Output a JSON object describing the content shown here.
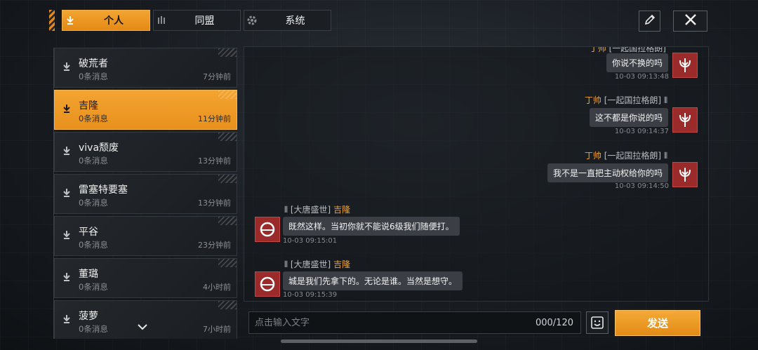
{
  "tabs": [
    {
      "label": "个人",
      "icon": "person-pin-icon",
      "active": true
    },
    {
      "label": "同盟",
      "icon": "alliance-icon",
      "active": false
    },
    {
      "label": "系统",
      "icon": "gear-icon",
      "active": false
    }
  ],
  "toolbar": {
    "edit_icon": "pencil-icon",
    "close_icon": "close-icon"
  },
  "conversations": [
    {
      "name": "破荒者",
      "count": "0条消息",
      "time": "7分钟前"
    },
    {
      "name": "吉隆",
      "count": "0条消息",
      "time": "11分钟前"
    },
    {
      "name": "viva颓废",
      "count": "0条消息",
      "time": "13分钟前"
    },
    {
      "name": "雷塞特要塞",
      "count": "0条消息",
      "time": "13分钟前"
    },
    {
      "name": "平谷",
      "count": "0条消息",
      "time": "23分钟前"
    },
    {
      "name": "董璐",
      "count": "0条消息",
      "time": "4小时前"
    },
    {
      "name": "菠萝",
      "count": "0条消息",
      "time": "7小时前"
    }
  ],
  "messages": [
    {
      "side": "right",
      "name": "丁帅",
      "guild": "[一起国拉格朗]",
      "text": "你说不换的吗",
      "time": "10-03 09:13:48"
    },
    {
      "side": "right",
      "name": "丁帅",
      "guild": "[一起国拉格朗]",
      "text": "这不都是你说的吗",
      "time": "10-03 09:14:37"
    },
    {
      "side": "right",
      "name": "丁帅",
      "guild": "[一起国拉格朗]",
      "text": "我不是一直把主动权给你的吗",
      "time": "10-03 09:14:50"
    },
    {
      "side": "left",
      "name": "吉隆",
      "guild": "[大唐盛世]",
      "text": "既然这样。当初你就不能说6级我们随便打。",
      "time": "10-03 09:15:01"
    },
    {
      "side": "left",
      "name": "吉隆",
      "guild": "[大唐盛世]",
      "text": "城是我们先拿下的。无论是谁。当然是想守。",
      "time": "10-03 09:15:39"
    }
  ],
  "input": {
    "placeholder": "点击输入文字",
    "counter": "000/120"
  },
  "send_label": "发送",
  "colors": {
    "accent": "#e8901d",
    "name_highlight": "#f0a236",
    "avatar_red": "#9b2a2a"
  }
}
